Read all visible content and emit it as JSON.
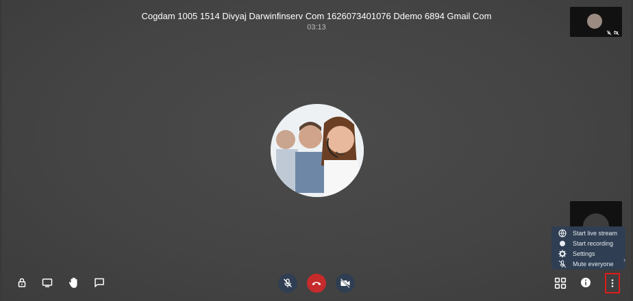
{
  "call": {
    "title": "Cogdam 1005 1514 Divyaj Darwinfinserv Com 1626073401076 Ddemo 6894 Gmail Com",
    "duration": "03:13"
  },
  "main_avatar": {
    "description_icon": "participant-avatar"
  },
  "more_menu": {
    "items": [
      {
        "label": "Start live stream",
        "icon": "globe-icon"
      },
      {
        "label": "Start recording",
        "icon": "record-icon"
      },
      {
        "label": "Settings",
        "icon": "gear-icon"
      },
      {
        "label": "Mute everyone",
        "icon": "mic-off-icon"
      }
    ]
  },
  "toolbar": {
    "left": [
      "lock-icon",
      "screen-share-icon",
      "raise-hand-icon",
      "chat-icon"
    ],
    "center": [
      "mic-off-icon",
      "hangup-icon",
      "video-off-icon"
    ],
    "right": [
      "tile-view-icon",
      "info-icon",
      "more-options-icon"
    ]
  },
  "colors": {
    "background": "#474747",
    "menu_bg": "#2f3e52",
    "hangup": "#c62b2b",
    "highlight": "#e01b1b"
  }
}
